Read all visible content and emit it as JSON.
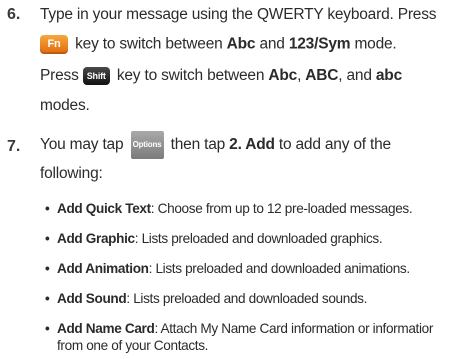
{
  "step6": {
    "number": "6.",
    "l1": "Type in your message using the QWERTY keyboard. Press",
    "fn_icon": "Fn",
    "l2_a": " key to switch between ",
    "abc": "Abc",
    "l2_b": " and ",
    "sym": "123/Sym",
    "l2_c": " mode.",
    "press": "Press",
    "shift_icon": "Shift",
    "l3_a": " key to switch between ",
    "abc2": "Abc",
    "comma1": ", ",
    "abc_upper": "ABC",
    "l3_b": ", and ",
    "abc_lower": "abc",
    "l4": "modes."
  },
  "step7": {
    "number": "7.",
    "l1_a": "You may tap ",
    "options_icon": "Options",
    "l1_b": " then tap ",
    "add": "2. Add",
    "l1_c": " to add any of the",
    "l2": "following:"
  },
  "bullets": [
    {
      "term": "Add Quick Text",
      "desc": ": Choose from up to 12 pre-loaded messages."
    },
    {
      "term": "Add Graphic",
      "desc": ": Lists preloaded and downloaded graphics."
    },
    {
      "term": "Add Animation",
      "desc": ": Lists preloaded and downloaded animations."
    },
    {
      "term": "Add Sound",
      "desc": ": Lists preloaded and downloaded sounds."
    },
    {
      "term": "Add Name Card",
      "desc": ": Attach My Name Card information or informatior",
      "cont": "from one of your Contacts."
    }
  ],
  "colors": {
    "fn_key": "#e8801f",
    "shift_key": "#222222",
    "options_key": "#8e8e8e"
  }
}
